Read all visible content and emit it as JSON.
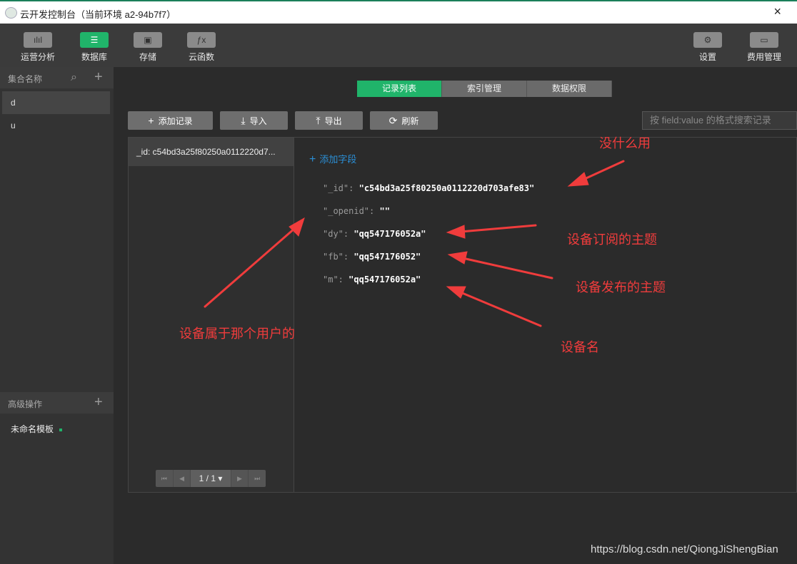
{
  "window": {
    "title": "云开发控制台（当前环境 a2-94b7f7）",
    "close_glyph": "×"
  },
  "toolbar": {
    "items": [
      {
        "label": "运营分析",
        "icon": "bar-chart-icon",
        "glyph": "ılıl"
      },
      {
        "label": "数据库",
        "icon": "database-icon",
        "glyph": "☰",
        "active": true
      },
      {
        "label": "存储",
        "icon": "storage-icon",
        "glyph": "▣"
      },
      {
        "label": "云函数",
        "icon": "function-icon",
        "glyph": "ƒx"
      }
    ],
    "right_items": [
      {
        "label": "设置",
        "icon": "gear-icon",
        "glyph": "⚙"
      },
      {
        "label": "费用管理",
        "icon": "billing-icon",
        "glyph": "▭"
      }
    ]
  },
  "sidebar": {
    "header": {
      "label": "集合名称",
      "search_glyph": "⌕",
      "add_glyph": "+"
    },
    "collections": [
      {
        "label": "d",
        "active": true
      },
      {
        "label": "u"
      }
    ],
    "advanced": {
      "label": "高级操作",
      "add_glyph": "+"
    },
    "templates": [
      {
        "label": "未命名模板"
      }
    ]
  },
  "tabs": [
    {
      "label": "记录列表",
      "active": true
    },
    {
      "label": "索引管理"
    },
    {
      "label": "数据权限"
    }
  ],
  "actions": {
    "add_record": {
      "label": "添加记录",
      "icon": "plus-icon",
      "glyph": "+"
    },
    "import": {
      "label": "导入",
      "icon": "import-icon",
      "glyph": "⤓"
    },
    "export": {
      "label": "导出",
      "icon": "export-icon",
      "glyph": "⤒"
    },
    "refresh": {
      "label": "刷新",
      "icon": "refresh-icon",
      "glyph": "⟳"
    }
  },
  "search": {
    "placeholder": "按 field:value 的格式搜索记录"
  },
  "records": {
    "items": [
      "_id: c54bd3a25f80250a0112220d7..."
    ]
  },
  "pager": {
    "first": "⏮",
    "prev": "◀",
    "page": "1 / 1 ▾",
    "next": "▶",
    "last": "⏭"
  },
  "document": {
    "add_field": "添加字段",
    "add_field_glyph": "+",
    "fields": [
      {
        "key": "\"_id\":",
        "value": "\"c54bd3a25f80250a0112220d703afe83\""
      },
      {
        "key": "\"_openid\":",
        "value": "\"\""
      },
      {
        "key": "\"dy\":",
        "value": "\"qq547176052a\""
      },
      {
        "key": "\"fb\":",
        "value": "\"qq547176052\""
      },
      {
        "key": "\"m\":",
        "value": "\"qq547176052a\""
      }
    ]
  },
  "annotations": {
    "useless": "没什么用",
    "subscribe_topic": "设备订阅的主题",
    "publish_topic": "设备发布的主题",
    "device_name": "设备名",
    "owner": "设备属于那个用户的",
    "color": "#f03c3c"
  },
  "watermark": "https://blog.csdn.net/QiongJiShengBian"
}
